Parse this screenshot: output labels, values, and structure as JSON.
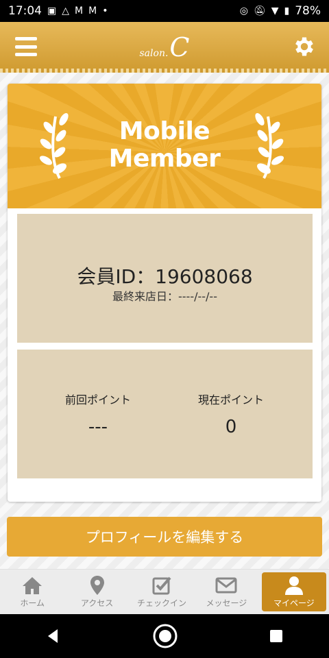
{
  "status_bar": {
    "time": "17:04",
    "battery": "78%",
    "icons_left": [
      "image-icon",
      "drive-icon",
      "gmail-icon",
      "gmail-icon",
      "dot-icon"
    ],
    "icons_right": [
      "nfc-icon",
      "mute-icon",
      "wifi-icon",
      "battery-icon"
    ]
  },
  "header": {
    "logo_small": "salon.",
    "logo_big": "C",
    "menu_icon": "hamburger-icon",
    "settings_icon": "gear-icon",
    "color": "#d9a440"
  },
  "banner": {
    "title_line1": "Mobile",
    "title_line2": "Member",
    "color": "#f0b43a"
  },
  "member": {
    "id_text": "会員ID：19608068",
    "last_visit": "最終来店日：----/--/--"
  },
  "points": {
    "previous_label": "前回ポイント",
    "previous_value": "---",
    "current_label": "現在ポイント",
    "current_value": "0"
  },
  "edit_profile_label": "プロフィールを編集する",
  "tabs": [
    {
      "label": "ホーム",
      "icon": "home-icon"
    },
    {
      "label": "アクセス",
      "icon": "map-pin-icon"
    },
    {
      "label": "チェックイン",
      "icon": "checkbox-icon"
    },
    {
      "label": "メッセージ",
      "icon": "mail-icon"
    },
    {
      "label": "マイページ",
      "icon": "user-icon",
      "active": true
    }
  ],
  "colors": {
    "accent": "#e7a935",
    "panel": "#e1d3b8",
    "active_tab": "#c88a1c"
  }
}
